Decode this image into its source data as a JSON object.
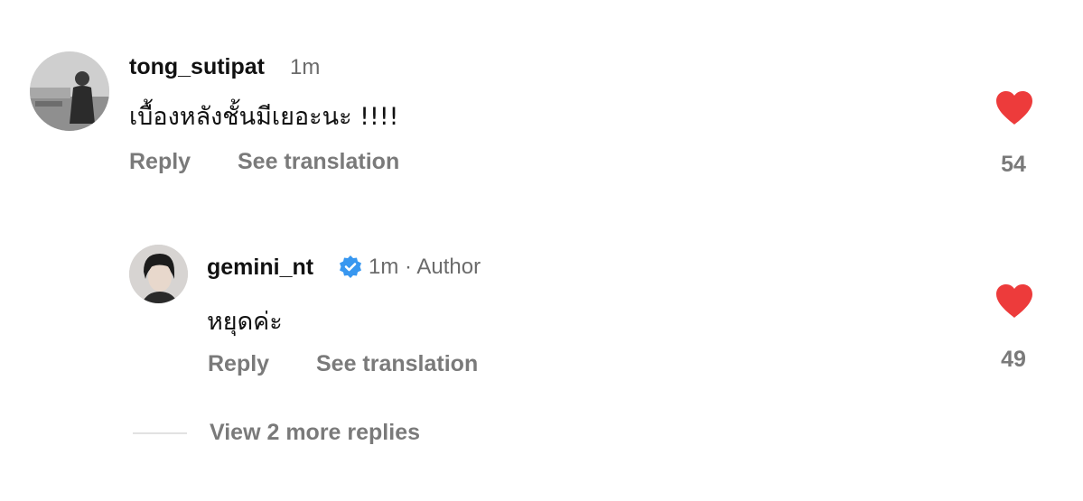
{
  "comments": [
    {
      "username": "tong_sutipat",
      "time": "1m",
      "text": "เบื้องหลังชั้นมีเยอะนะ !!!!",
      "reply_label": "Reply",
      "translate_label": "See translation",
      "like_count": "54"
    },
    {
      "username": "gemini_nt",
      "time_author": "1m · Author",
      "text": "หยุดค่ะ",
      "reply_label": "Reply",
      "translate_label": "See translation",
      "like_count": "49"
    }
  ],
  "view_more_label": "View 2 more replies",
  "colors": {
    "heart": "#ed3b3b",
    "verified": "#3897f0",
    "secondary_text": "#7a7a7a"
  },
  "icons": {
    "like": "heart-icon",
    "verified": "verified-badge-icon"
  }
}
